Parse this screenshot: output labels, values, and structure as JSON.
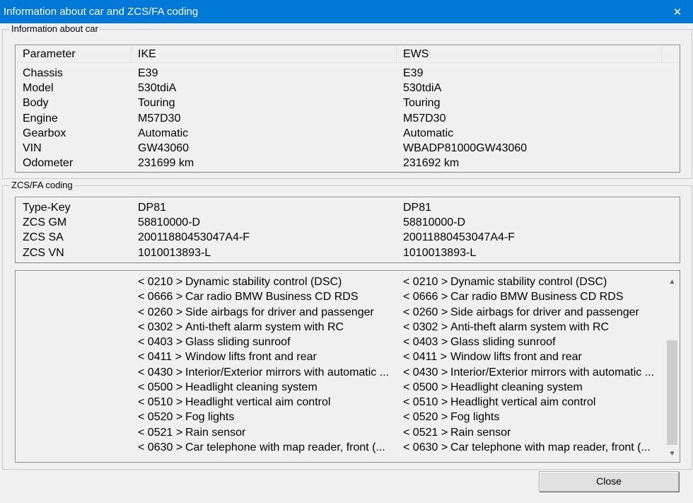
{
  "window": {
    "title": "Information about car and ZCS/FA coding",
    "close_glyph": "✕"
  },
  "car_info": {
    "legend": "Information about car",
    "columns": [
      "Parameter",
      "IKE",
      "EWS"
    ],
    "rows": [
      [
        "Chassis",
        "E39",
        "E39"
      ],
      [
        "Model",
        "530tdiA",
        "530tdiA"
      ],
      [
        "Body",
        "Touring",
        "Touring"
      ],
      [
        "Engine",
        "M57D30",
        "M57D30"
      ],
      [
        "Gearbox",
        "Automatic",
        "Automatic"
      ],
      [
        "VIN",
        "GW43060",
        "WBADP81000GW43060"
      ],
      [
        "Odometer",
        "231699 km",
        "231692 km"
      ]
    ]
  },
  "zcs": {
    "legend": "ZCS/FA coding",
    "rows": [
      [
        "Type-Key",
        "DP81",
        "DP81"
      ],
      [
        "ZCS GM",
        "58810000-D",
        "58810000-D"
      ],
      [
        "ZCS SA",
        "20011880453047A4-F",
        "20011880453047A4-F"
      ],
      [
        "ZCS VN",
        "1010013893-L",
        "1010013893-L"
      ]
    ],
    "options": [
      {
        "code": "< 0210 >",
        "ike": "Dynamic stability control (DSC)",
        "ews": "Dynamic stability control (DSC)"
      },
      {
        "code": "< 0666 >",
        "ike": "Car radio BMW Business CD RDS",
        "ews": "Car radio BMW Business CD RDS"
      },
      {
        "code": "< 0260 >",
        "ike": "Side airbags for driver and passenger",
        "ews": "Side airbags for driver and passenger"
      },
      {
        "code": "< 0302 >",
        "ike": "Anti-theft alarm system with RC",
        "ews": "Anti-theft alarm system with RC"
      },
      {
        "code": "< 0403 >",
        "ike": "Glass sliding sunroof",
        "ews": "Glass sliding sunroof"
      },
      {
        "code": "< 0411 >",
        "ike": "Window lifts front and rear",
        "ews": "Window lifts front and rear"
      },
      {
        "code": "< 0430 >",
        "ike": "Interior/Exterior mirrors with automatic ...",
        "ews": "Interior/Exterior mirrors with automatic ..."
      },
      {
        "code": "< 0500 >",
        "ike": "Headlight cleaning system",
        "ews": "Headlight cleaning system"
      },
      {
        "code": "< 0510 >",
        "ike": "Headlight vertical aim control",
        "ews": "Headlight vertical aim control"
      },
      {
        "code": "< 0520 >",
        "ike": "Fog lights",
        "ews": "Fog lights"
      },
      {
        "code": "< 0521 >",
        "ike": "Rain sensor",
        "ews": "Rain sensor"
      },
      {
        "code": "< 0630 >",
        "ike": "Car telephone with map reader, front (...",
        "ews": "Car telephone with map reader, front (..."
      }
    ],
    "scroll_up_glyph": "▲",
    "scroll_down_glyph": "▼"
  },
  "buttons": {
    "close": "Close"
  }
}
